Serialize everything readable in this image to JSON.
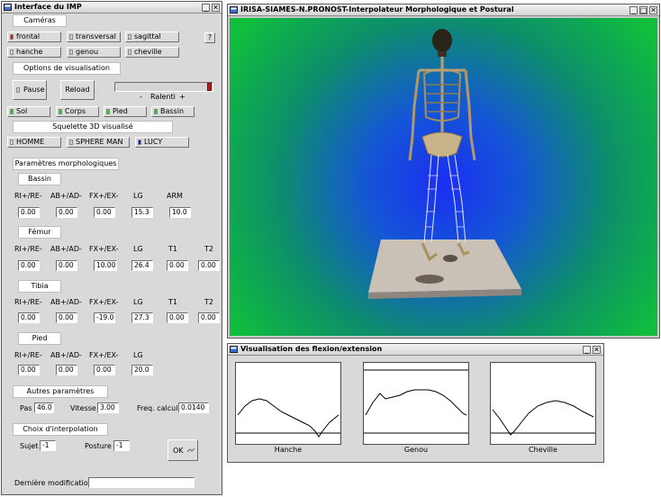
{
  "left_window": {
    "title": "Interface du IMP",
    "buttons": {
      "minimize": "_",
      "close": "✕"
    },
    "sections": {
      "cameras": "Caméras",
      "options": "Options de visualisation",
      "skeleton": "Squelette 3D visualisé",
      "morpho": "Paramètres morphologiques",
      "bassin": "Bassin",
      "femur": "Fémur",
      "tibia": "Tibia",
      "pied": "Pied",
      "autres": "Autres paramètres",
      "interp": "Choix d'interpolation"
    },
    "cameras": [
      "frontal",
      "transversal",
      "sagittal",
      "hanche",
      "genou",
      "cheville"
    ],
    "help_label": "?",
    "pause_label": "Pause",
    "reload_label": "Reload",
    "slow_minus": "-",
    "slow_label": "Ralenti",
    "slow_plus": "+",
    "display_toggles": [
      "Sol",
      "Corps",
      "Pied",
      "Bassin"
    ],
    "skeletons": [
      "HOMME",
      "SPHERE MAN",
      "LUCY"
    ],
    "bassin": {
      "headers": [
        "RI+/RE-",
        "AB+/AD-",
        "FX+/EX-",
        "LG",
        "ARM"
      ],
      "values": [
        "0.00",
        "0.00",
        "0.00",
        "15.3",
        "10.0"
      ]
    },
    "femur": {
      "headers": [
        "RI+/RE-",
        "AB+/AD-",
        "FX+/EX-",
        "LG",
        "T1",
        "T2"
      ],
      "values": [
        "0.00",
        "0.00",
        "10.00",
        "26.4",
        "0.00",
        "0.00"
      ]
    },
    "tibia": {
      "headers": [
        "RI+/RE-",
        "AB+/AD-",
        "FX+/EX-",
        "LG",
        "T1",
        "T2"
      ],
      "values": [
        "0.00",
        "0.00",
        "-19.0",
        "27.3",
        "0.00",
        "0.00"
      ]
    },
    "pied": {
      "headers": [
        "RI+/RE-",
        "AB+/AD-",
        "FX+/EX-",
        "LG"
      ],
      "values": [
        "0.00",
        "0.00",
        "0.00",
        "20.0"
      ]
    },
    "autres": {
      "pas_label": "Pas",
      "pas_value": "46.0",
      "vitesse_label": "Vitesse",
      "vitesse_value": "3.00",
      "freq_label": "Freq. calcul",
      "freq_value": "0.0140"
    },
    "interp": {
      "sujet_label": "Sujet",
      "sujet_value": "-1",
      "posture_label": "Posture",
      "posture_value": "-1",
      "ok_label": "OK"
    },
    "last_mod_label": "Dernière modification",
    "last_mod_value": ""
  },
  "viewer_window": {
    "title": "IRISA-SIAMES-N.PRONOST-Interpolateur Morphologique et Postural",
    "buttons": {
      "minimize": "_",
      "maximize": "□",
      "close": "✕"
    }
  },
  "graph_window": {
    "title": "Visualisation des flexion/extension",
    "buttons": {
      "minimize": "_",
      "close": "✕"
    },
    "captions": [
      "Hanche",
      "Genou",
      "Cheville"
    ]
  },
  "colors": {
    "active_led_red": "#d01010",
    "active_led_green": "#22cc22",
    "active_led_blue": "#1020c0",
    "viewer_center": "#1a3cf0",
    "viewer_edge": "#0fbf3a"
  }
}
